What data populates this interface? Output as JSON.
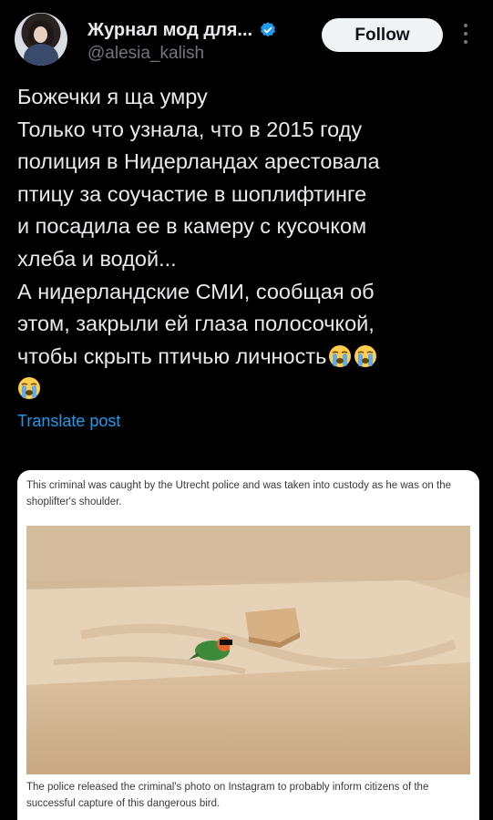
{
  "author": {
    "display_name": "Журнал мод для...",
    "handle": "@alesia_kalish",
    "verified_icon": "verified-badge-icon"
  },
  "actions": {
    "follow_label": "Follow",
    "more_icon": "more-vertical-icon"
  },
  "tweet": {
    "lines": [
      "Божечки я ща умру",
      "Только что узнала, что в 2015 году",
      "полиция в Нидерландах арестовала",
      "птицу за соучастие в шоплифтинге",
      "и посадила ее в камеру с кусочком",
      "хлеба и водой...",
      "А нидерландские СМИ, сообщая об",
      "этом, закрыли ей глаза полосочкой,",
      "чтобы скрыть птичью личность"
    ],
    "emoji": "😭😭😭",
    "translate_label": "Translate post"
  },
  "media": {
    "caption_top": "This criminal was caught by the Utrecht police and was taken into custody as he was on the shoplifter's shoulder.",
    "caption_bottom": "The police released the criminal's photo on Instagram to probably inform citizens of the successful capture of this dangerous bird.",
    "photo_subject": "lovebird-in-cell-with-bread",
    "colors": {
      "wall": "#d9c3a5",
      "floor": "#e2cdb0",
      "bread": "#d8b487",
      "bird_green": "#3c8a3a",
      "bird_orange": "#e0672f"
    }
  },
  "colors": {
    "background": "#000000",
    "text": "#e7e9ea",
    "muted": "#71767b",
    "link": "#1d9bf0",
    "button_bg": "#eff3f4"
  }
}
